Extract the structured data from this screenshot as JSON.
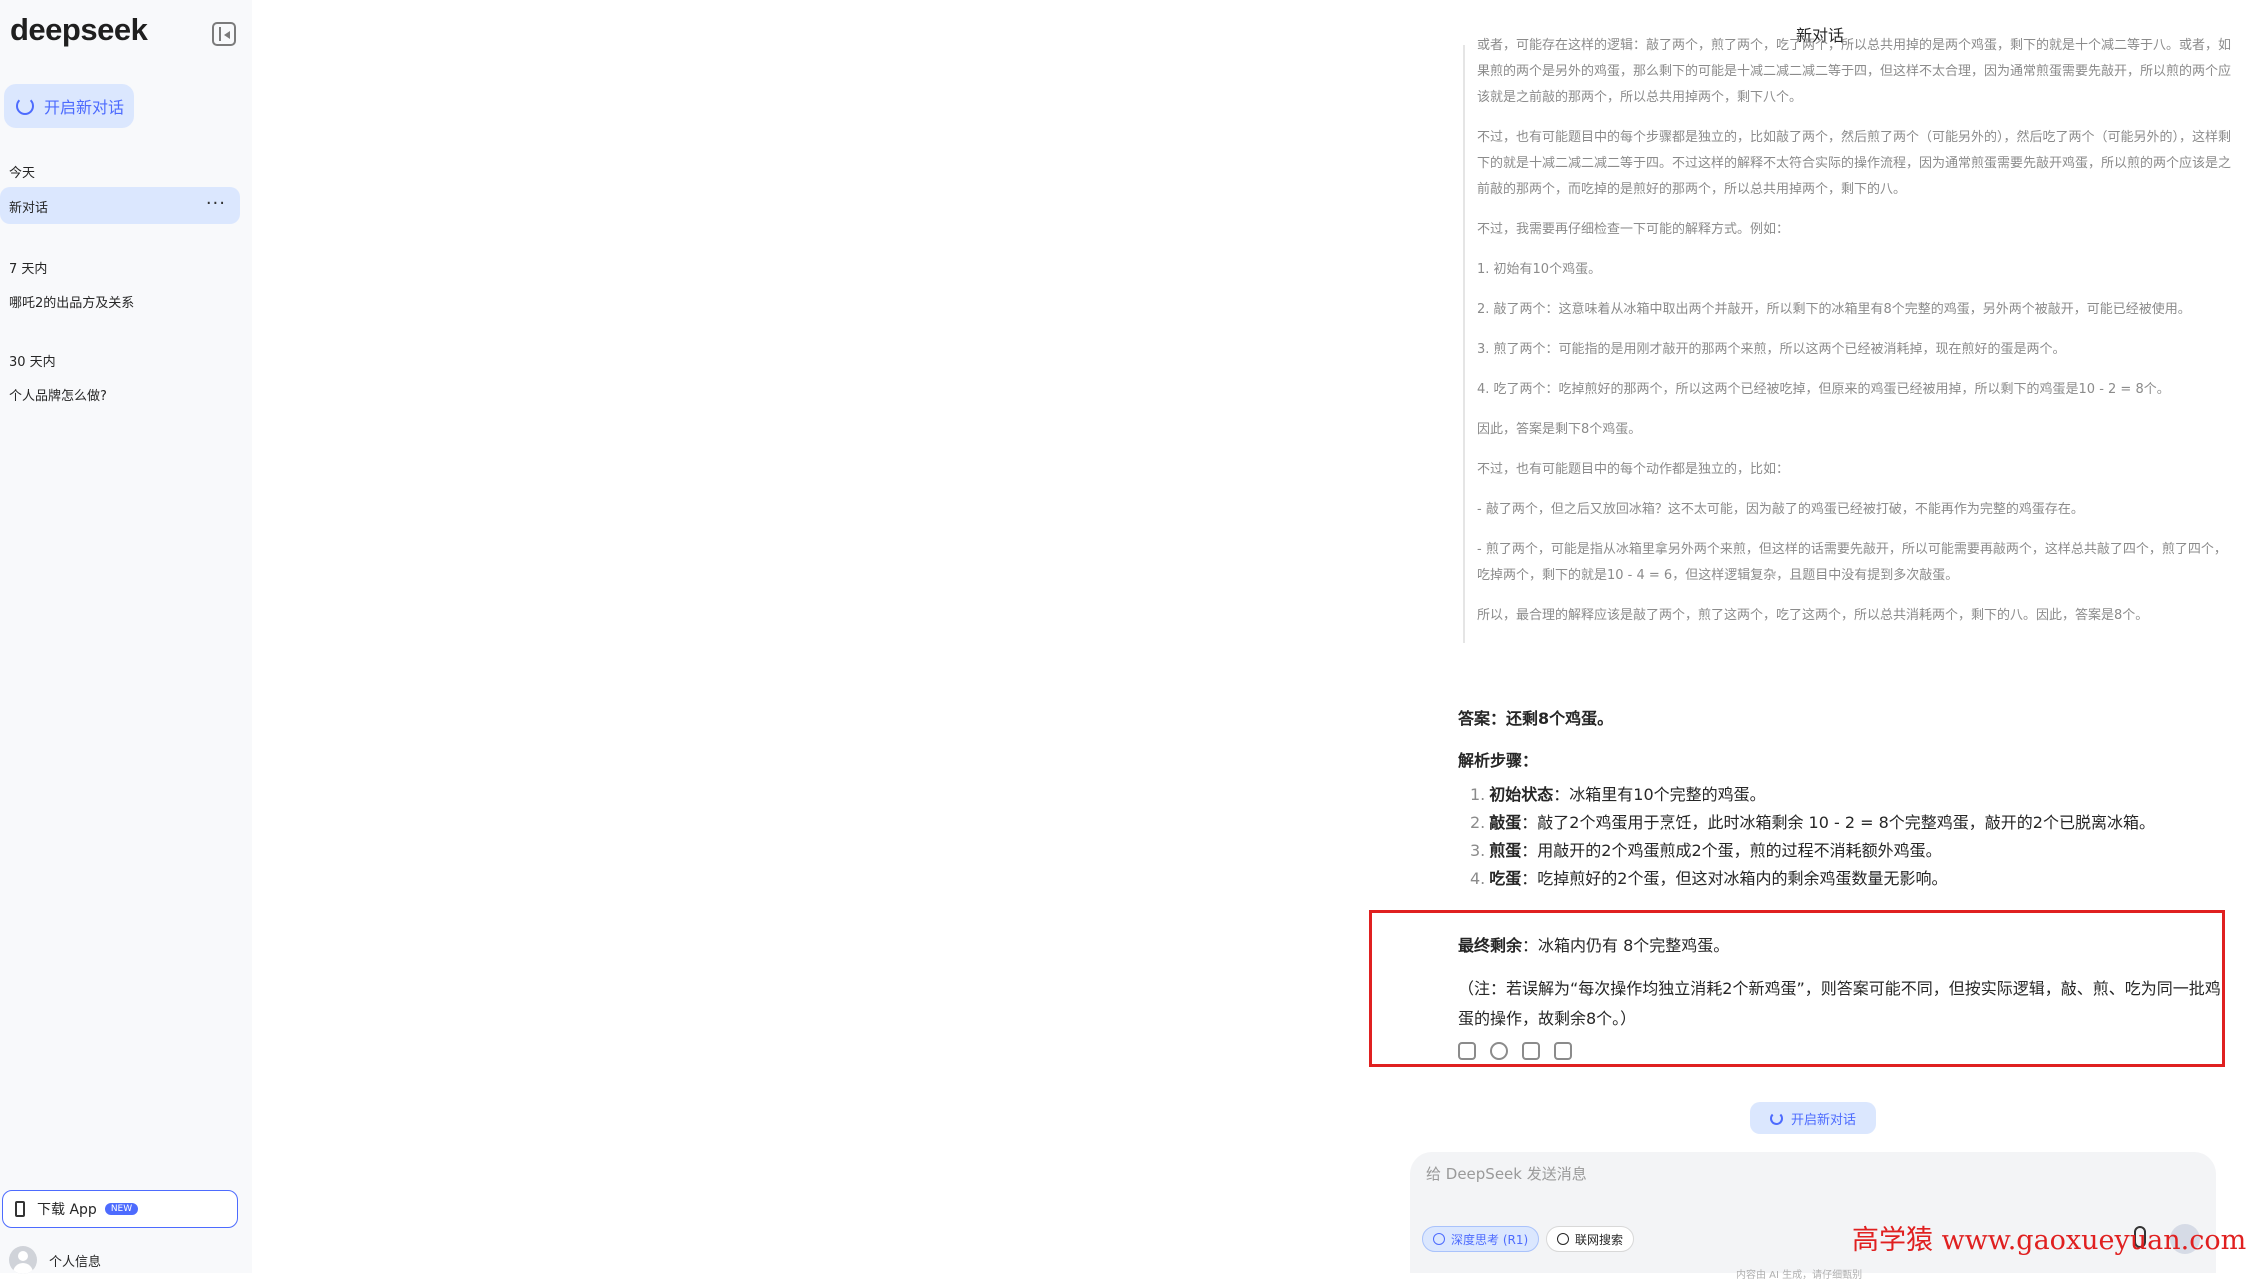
{
  "sidebar": {
    "logo": "deepseek",
    "new_chat": "开启新对话",
    "groups": [
      {
        "label": "今天",
        "items": [
          "新对话"
        ]
      },
      {
        "label": "7 天内",
        "items": [
          "哪吒2的出品方及关系"
        ]
      },
      {
        "label": "30 天内",
        "items": [
          "个人品牌怎么做?"
        ]
      }
    ],
    "active_more": "···",
    "download_app": "下载 App",
    "download_badge": "NEW",
    "profile": "个人信息"
  },
  "chat": {
    "title": "新对话",
    "thinking": [
      "或者，可能存在这样的逻辑：敲了两个，煎了两个，吃了两个，所以总共用掉的是两个鸡蛋，剩下的就是十个减二等于八。或者，如果煎的两个是另外的鸡蛋，那么剩下的可能是十减二减二减二等于四，但这样不太合理，因为通常煎蛋需要先敲开，所以煎的两个应该就是之前敲的那两个，所以总共用掉两个，剩下八个。",
      "不过，也有可能题目中的每个步骤都是独立的，比如敲了两个，然后煎了两个（可能另外的），然后吃了两个（可能另外的），这样剩下的就是十减二减二减二等于四。不过这样的解释不太符合实际的操作流程，因为通常煎蛋需要先敲开鸡蛋，所以煎的两个应该是之前敲的那两个，而吃掉的是煎好的那两个，所以总共用掉两个，剩下的八。",
      "不过，我需要再仔细检查一下可能的解释方式。例如：",
      "1. 初始有10个鸡蛋。",
      "2. 敲了两个：这意味着从冰箱中取出两个并敲开，所以剩下的冰箱里有8个完整的鸡蛋，另外两个被敲开，可能已经被使用。",
      "3. 煎了两个：可能指的是用刚才敲开的那两个来煎，所以这两个已经被消耗掉，现在煎好的蛋是两个。",
      "4. 吃了两个：吃掉煎好的那两个，所以这两个已经被吃掉，但原来的鸡蛋已经被用掉，所以剩下的鸡蛋是10 - 2 = 8个。",
      "因此，答案是剩下8个鸡蛋。",
      "不过，也有可能题目中的每个动作都是独立的，比如：",
      "- 敲了两个，但之后又放回冰箱？这不太可能，因为敲了的鸡蛋已经被打破，不能再作为完整的鸡蛋存在。",
      "- 煎了两个，可能是指从冰箱里拿另外两个来煎，但这样的话需要先敲开，所以可能需要再敲两个，这样总共敲了四个，煎了四个，吃掉两个，剩下的就是10 - 4 = 6，但这样逻辑复杂，且题目中没有提到多次敲蛋。",
      "所以，最合理的解释应该是敲了两个，煎了这两个，吃了这两个，所以总共消耗两个，剩下的八。因此，答案是8个。"
    ],
    "answer_heading": "答案：还剩8个鸡蛋。",
    "steps_heading": "解析步骤：",
    "steps": [
      {
        "num": "1.",
        "title": "初始状态",
        "text": "：冰箱里有10个完整的鸡蛋。"
      },
      {
        "num": "2.",
        "title": "敲蛋",
        "text": "：敲了2个鸡蛋用于烹饪，此时冰箱剩余 10 - 2 = 8个完整鸡蛋，敲开的2个已脱离冰箱。"
      },
      {
        "num": "3.",
        "title": "煎蛋",
        "text": "：用敲开的2个鸡蛋煎成2个蛋，煎的过程不消耗额外鸡蛋。"
      },
      {
        "num": "4.",
        "title": "吃蛋",
        "text": "：吃掉煎好的2个蛋，但这对冰箱内的剩余鸡蛋数量无影响。"
      }
    ],
    "final_label": "最终剩余",
    "final_text": "：冰箱内仍有 8个完整鸡蛋。",
    "note": "（注：若误解为“每次操作均独立消耗2个新鸡蛋”，则答案可能不同，但按实际逻辑，敲、煎、吃为同一批鸡蛋的操作，故剩余8个。）",
    "new_chat_pill": "开启新对话"
  },
  "input": {
    "placeholder": "给 DeepSeek 发送消息",
    "deep_think": "深度思考 (R1)",
    "web_search": "联网搜索"
  },
  "watermark": "高学猿 www.gaoxueyuan.com",
  "footnote": "内容由 AI 生成，请仔细甄别",
  "colors": {
    "accent": "#4d6bfe",
    "highlight": "#e02020",
    "sidebar_bg": "#f8f9fb"
  }
}
